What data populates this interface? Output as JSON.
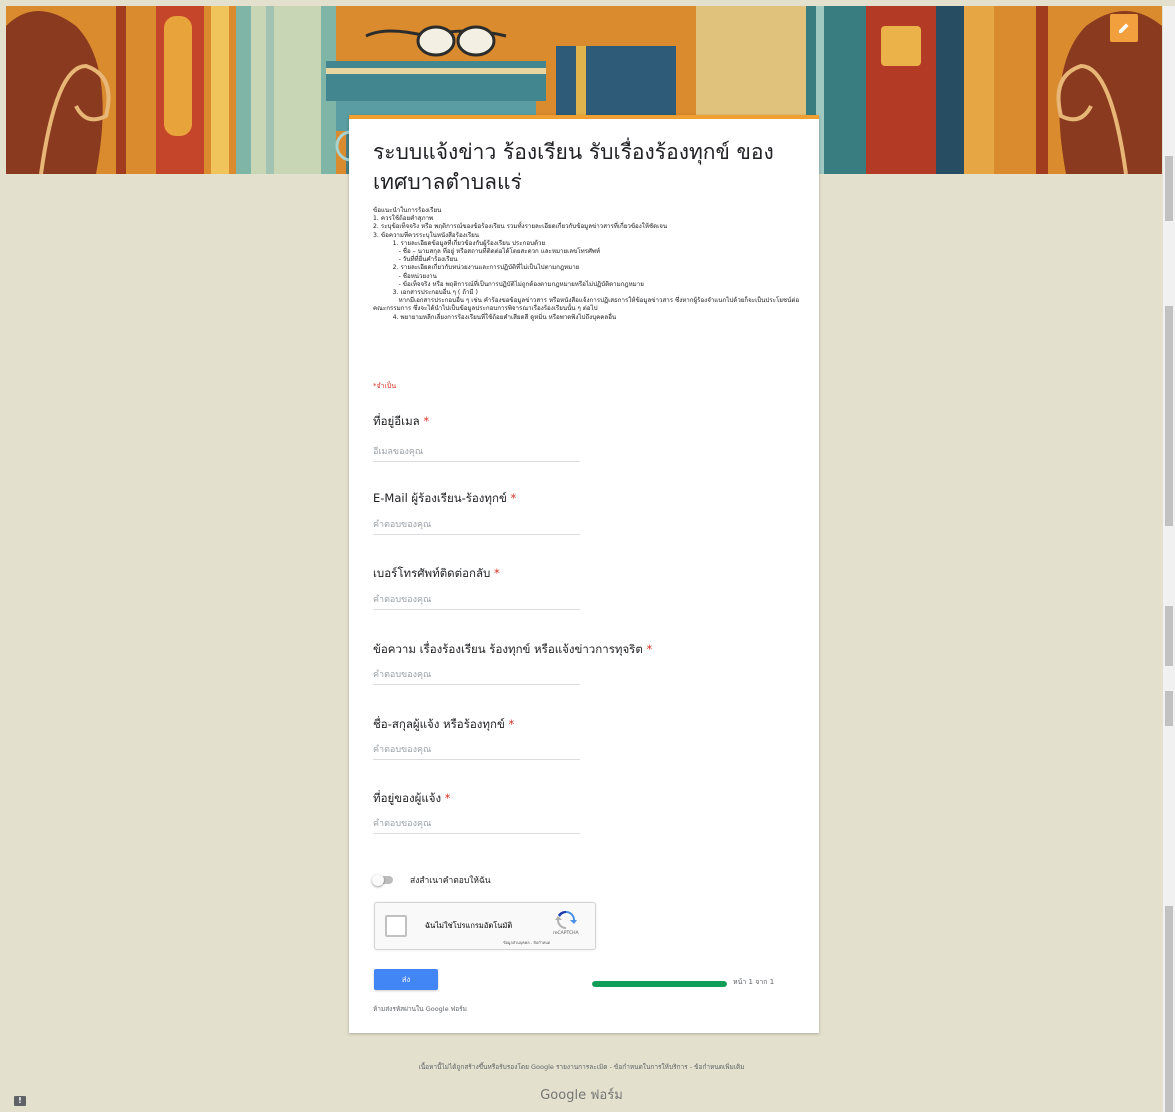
{
  "form": {
    "title": "ระบบแจ้งข่าว ร้องเรียน รับเรื่องร้องทุกข์ ของ เทศบาลตำบลแร่",
    "description": "ข้อแนะนำในการร้องเรียน\n1. ควรใช้ถ้อยคำสุภาพ\n2. ระบุข้อเท็จจริง หรือ พฤติการณ์ของข้อร้องเรียน รวมทั้งรายละเอียดเกี่ยวกับข้อมูลข่าวสารที่เกี่ยวข้องให้ชัดเจน\n3. ข้อความที่ควรระบุในหนังสือร้องเรียน\n          1. รายละเอียดข้อมูลที่เกี่ยวข้องกับผู้ร้องเรียน ประกอบด้วย\n             - ชื่อ – นามสกุล ที่อยู่ หรือสถานที่ติดต่อได้โดยสะดวก และหมายเลขโทรศัพท์\n             - วันที่ที่ยื่นคำร้องเรียน\n          2. รายละเอียดเกี่ยวกับหน่วยงานและการปฏิบัติที่ไม่เป็นไปตามกฎหมาย\n             - ชื่อหน่วยงาน\n             - ข้อเท็จจริง หรือ พฤติการณ์ที่เป็นการปฏิบัติไม่ถูกต้องตามกฎหมายหรือไม่ปฏิบัติตามกฎหมาย\n          3. เอกสารประกอบอื่น ๆ ( ถ้ามี )\n             หากมีเอกสารประกอบอื่น ๆ เช่น คำร้องขอข้อมูลข่าวสาร หรือหนังสือแจ้งการปฏิเสธการให้ข้อมูลข่าวสาร ซึ่งหากผู้ร้องจำแนกไปด้วยก็จะเป็นประโยชน์ต่อคณะกรรมการ ซึ่งจะได้นำไปเป็นข้อมูลประกอบการพิจารณาเรื่องร้องเรียนนั้น ๆ ต่อไป\n          4. พยายามหลีกเลี่ยงการร้องเรียนที่ใช้ถ้อยคำเสียดสี ดูหมิ่น หรือพาดพิงไปถึงบุคคลอื่น",
    "required_note": "*จำเป็น"
  },
  "questions": [
    {
      "label": "ที่อยู่อีเมล",
      "required_mark": "*",
      "placeholder": "อีเมลของคุณ"
    },
    {
      "label": "E-Mail ผู้ร้องเรียน-ร้องทุกข์",
      "required_mark": "*",
      "placeholder": "คำตอบของคุณ"
    },
    {
      "label": "เบอร์โทรศัพท์ติดต่อกลับ",
      "required_mark": "*",
      "placeholder": "คำตอบของคุณ"
    },
    {
      "label": "ข้อความ เรื่องร้องเรียน ร้องทุกข์ หรือแจ้งข่าวการทุจริต",
      "required_mark": "*",
      "placeholder": "คำตอบของคุณ"
    },
    {
      "label": "ชื่อ-สกุลผู้แจ้ง หรือร้องทุกข์",
      "required_mark": "*",
      "placeholder": "คำตอบของคุณ"
    },
    {
      "label": "ที่อยู่ของผู้แจ้ง",
      "required_mark": "*",
      "placeholder": "คำตอบของคุณ"
    }
  ],
  "copy_toggle": {
    "label": "ส่งสำเนาคำตอบให้ฉัน",
    "checked": false
  },
  "captcha": {
    "label": "ฉันไม่ใช่โปรแกรมอัตโนมัติ",
    "brand": "reCAPTCHA",
    "links": "ข้อมูลส่วนบุคคล - ข้อกำหนด"
  },
  "submit_label": "ส่ง",
  "progress": {
    "fraction": 1.0,
    "label": "หน้า 1 จาก 1"
  },
  "no_password_note": "ห้ามส่งรหัสผ่านใน Google ฟอร์ม",
  "footer": {
    "text": "เนื้อหานี้ไม่ได้ถูกสร้างขึ้นหรือรับรองโดย Google รายงานการละเมิด - ข้อกำหนดในการให้บริการ - ข้อกำหนดเพิ่มเติม",
    "logo": "Google ฟอร์ม"
  },
  "colors": {
    "background": "#e3e1cd",
    "accent": "#f0a030",
    "submit": "#4285f4",
    "progress": "#0f9d58",
    "required": "#d93025"
  },
  "icons": {
    "edit": "pencil-icon",
    "report": "report-icon",
    "captcha": "recaptcha-logo-icon"
  }
}
